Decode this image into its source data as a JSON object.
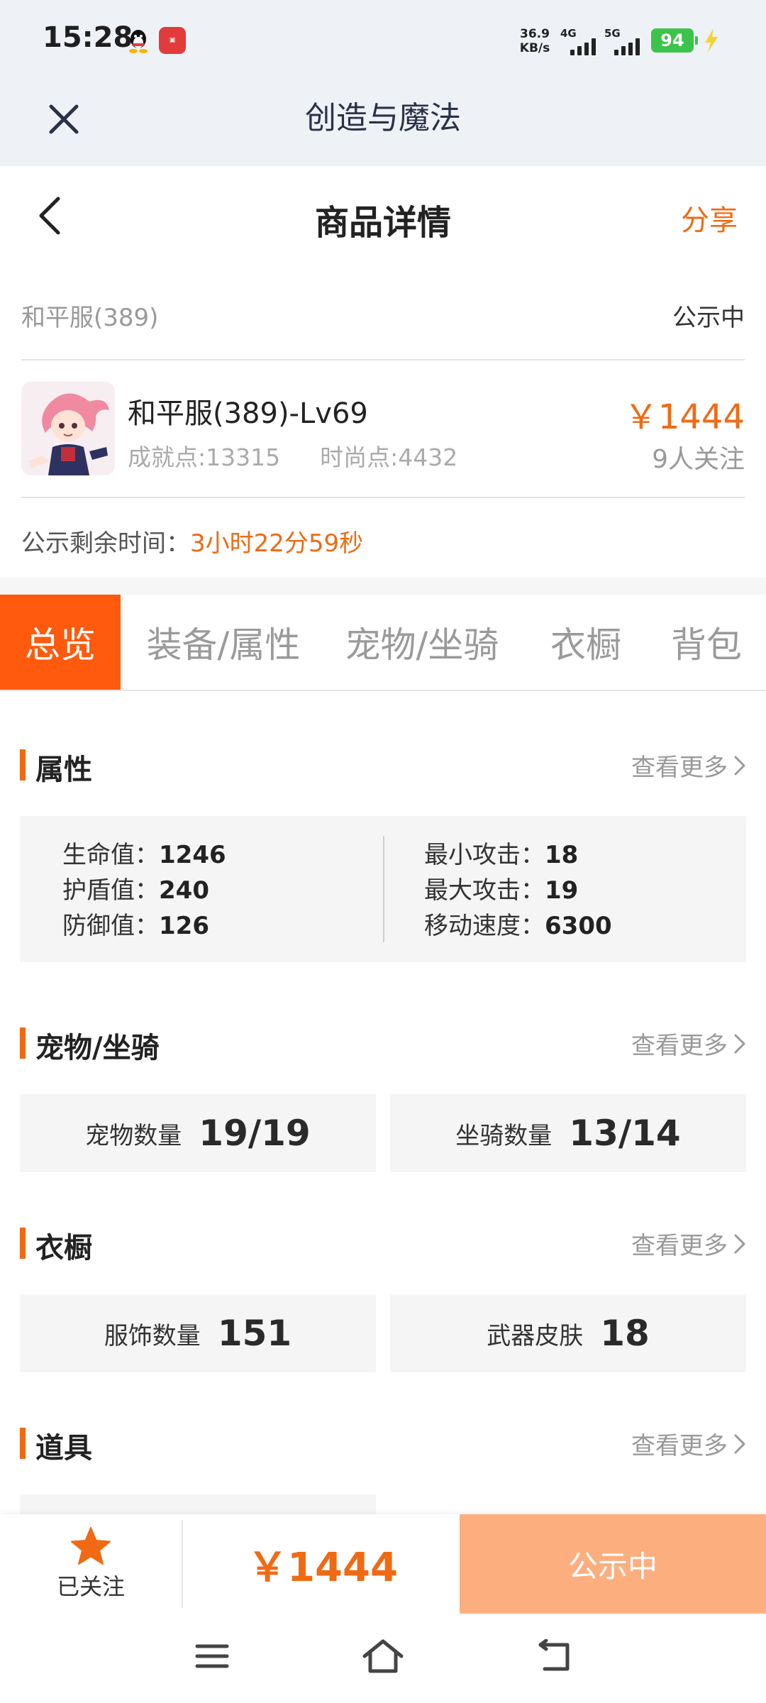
{
  "status_bar": {
    "time": "15:28",
    "net_speed_value": "36.9",
    "net_speed_unit": "KB/s",
    "signal_1": "4G",
    "signal_2": "5G",
    "battery": "94",
    "icons": [
      "qq-icon",
      "app-notification-icon",
      "signal-icon",
      "battery-icon",
      "charging-icon"
    ]
  },
  "mini_app": {
    "title": "创造与魔法",
    "close_icon": "close-icon"
  },
  "nav": {
    "title": "商品详情",
    "share": "分享",
    "back_icon": "chevron-left-icon"
  },
  "product": {
    "server_name": "和平服(389)",
    "status": "公示中",
    "name": "和平服(389)-Lv69",
    "achievement": "成就点:13315",
    "fashion": "时尚点:4432",
    "price": "￥1444",
    "followers": "9人关注",
    "remain_label": "公示剩余时间：",
    "remain_value": "3小时22分59秒"
  },
  "tabs": [
    {
      "label": "总览",
      "active": true
    },
    {
      "label": "装备/属性",
      "active": false
    },
    {
      "label": "宠物/坐骑",
      "active": false
    },
    {
      "label": "衣橱",
      "active": false
    },
    {
      "label": "背包",
      "active": false
    }
  ],
  "sections": {
    "more": "查看更多",
    "attributes": {
      "title": "属性",
      "left": [
        {
          "label": "生命值：",
          "value": "1246"
        },
        {
          "label": "护盾值：",
          "value": "240"
        },
        {
          "label": "防御值：",
          "value": "126"
        }
      ],
      "right": [
        {
          "label": "最小攻击：",
          "value": "18"
        },
        {
          "label": "最大攻击：",
          "value": "19"
        },
        {
          "label": "移动速度：",
          "value": "6300"
        }
      ]
    },
    "pets": {
      "title": "宠物/坐骑",
      "cards": [
        {
          "label": "宠物数量",
          "value": "19/19"
        },
        {
          "label": "坐骑数量",
          "value": "13/14"
        }
      ]
    },
    "wardrobe": {
      "title": "衣橱",
      "cards": [
        {
          "label": "服饰数量",
          "value": "151"
        },
        {
          "label": "武器皮肤",
          "value": "18"
        }
      ]
    },
    "items": {
      "title": "道具"
    }
  },
  "action_bar": {
    "follow_label": "已关注",
    "price": "￥1444",
    "status_button": "公示中",
    "star_color": "#f06a14"
  },
  "colors": {
    "accent": "#f06a14",
    "active_tab": "#ff5a0d",
    "disabled_button": "#fdae7f"
  }
}
